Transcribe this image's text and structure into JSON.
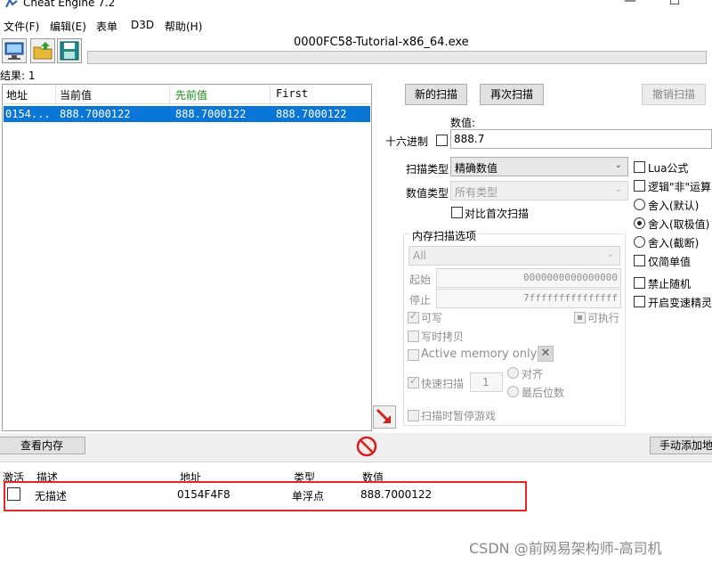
{
  "window": {
    "title": "Cheat Engine 7.2",
    "minimize_glyph": "—",
    "maximize_glyph": "☐"
  },
  "menu": [
    "文件(F)",
    "编辑(E)",
    "表单",
    "D3D",
    "帮助(H)"
  ],
  "toolbar": {
    "icons": [
      "computer-icon",
      "open-folder-icon",
      "save-disk-icon"
    ]
  },
  "process_name": "0000FC58-Tutorial-x86_64.exe",
  "results_label": "结果: 1",
  "results_table": {
    "headers": [
      "地址",
      "当前值",
      "先前值",
      "First"
    ],
    "header_colors": [
      "#000000",
      "#000000",
      "#1a8a1a",
      "#000000"
    ],
    "rows": [
      [
        "0154...",
        "888.7000122",
        "888.7000122",
        "888.7000122"
      ]
    ],
    "selection_color": "#0a76d8"
  },
  "scan_buttons": {
    "new_scan": "新的扫描",
    "next_scan": "再次扫描",
    "undo_scan": "撤销扫描"
  },
  "value_section": {
    "label": "数值:",
    "hex_label": "十六进制",
    "value": "888.7"
  },
  "scan_type": {
    "label": "扫描类型",
    "selected": "精确数值"
  },
  "value_type": {
    "label": "数值类型",
    "selected": "所有类型"
  },
  "compare_first": "对比首次扫描",
  "memory_options": {
    "title": "内存扫描选项",
    "region": "All",
    "start_label": "起始",
    "start_value": "0000000000000000",
    "stop_label": "停止",
    "stop_value": "7fffffffffffffff",
    "writable": "可写",
    "executable": "可执行",
    "copy_on_write": "写时拷贝",
    "active_memory": "Active memory only",
    "fast_scan": "快速扫描",
    "fast_scan_value": "1",
    "align": "对齐",
    "last_digits": "最后位数",
    "pause_game": "扫描时暂停游戏"
  },
  "right_options": {
    "lua": "Lua公式",
    "not_op": "逻辑\"非\"运算",
    "round_default": "舍入(默认)",
    "round_extreme": "舍入(取极值)",
    "round_truncate": "舍入(截断)",
    "simple_values": "仅简单值",
    "no_random": "禁止随机",
    "speedhack": "开启变速精灵"
  },
  "view_memory": "查看内存",
  "manual_add": "手动添加地",
  "cheat_table": {
    "headers": [
      "激活",
      "描述",
      "地址",
      "类型",
      "数值"
    ],
    "row": {
      "description": "无描述",
      "address": "0154F4F8",
      "type": "单浮点",
      "value": "888.7000122"
    },
    "highlight_color": "#e8262a"
  },
  "watermark": "CSDN @前网易架构师-高司机"
}
